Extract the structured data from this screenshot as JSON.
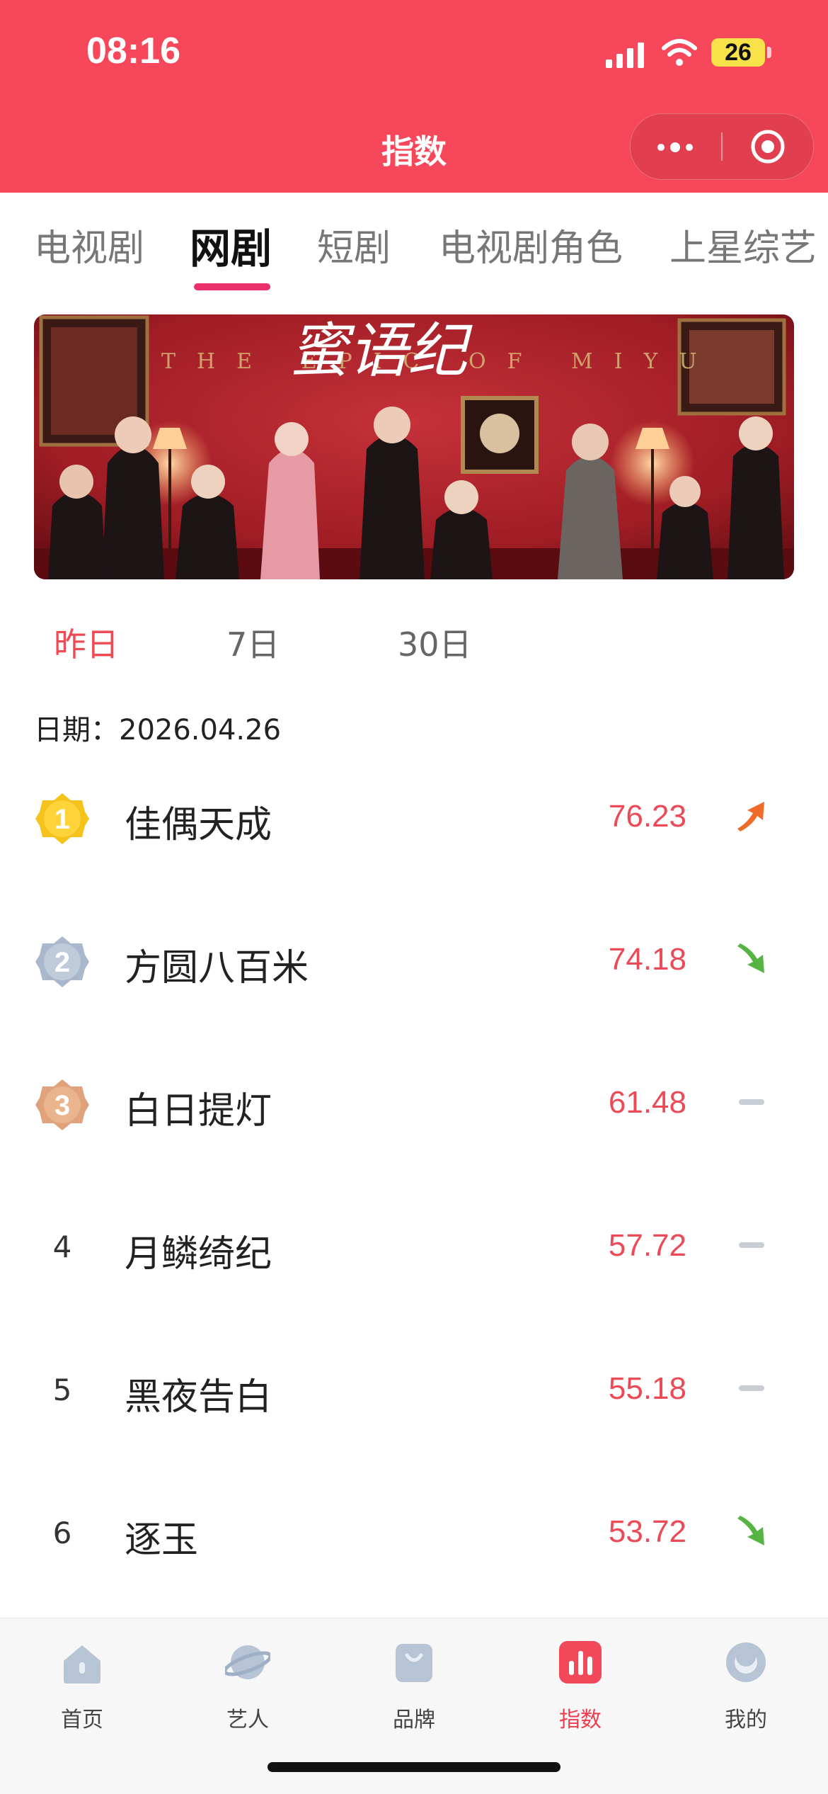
{
  "status_bar": {
    "time": "08:16",
    "battery": "26"
  },
  "header": {
    "title": "指数"
  },
  "tabs": [
    {
      "label": "电视剧",
      "active": false
    },
    {
      "label": "网剧",
      "active": true
    },
    {
      "label": "短剧",
      "active": false
    },
    {
      "label": "电视剧角色",
      "active": false
    },
    {
      "label": "上星综艺",
      "active": false
    }
  ],
  "banner": {
    "title_art": "蜜语纪",
    "subtitle_art": "THE EPIC OF MIYU"
  },
  "periods": [
    {
      "label": "昨日",
      "active": true
    },
    {
      "label": "7日",
      "active": false
    },
    {
      "label": "30日",
      "active": false
    }
  ],
  "date": {
    "label": "日期：",
    "value": "2026.04.26"
  },
  "ranking": [
    {
      "rank": "1",
      "title": "佳偶天成",
      "score": "76.23",
      "trend": "up"
    },
    {
      "rank": "2",
      "title": "方圆八百米",
      "score": "74.18",
      "trend": "down"
    },
    {
      "rank": "3",
      "title": "白日提灯",
      "score": "61.48",
      "trend": "flat"
    },
    {
      "rank": "4",
      "title": "月鳞绮纪",
      "score": "57.72",
      "trend": "flat"
    },
    {
      "rank": "5",
      "title": "黑夜告白",
      "score": "55.18",
      "trend": "flat"
    },
    {
      "rank": "6",
      "title": "逐玉",
      "score": "53.72",
      "trend": "down"
    }
  ],
  "bottom_nav": [
    {
      "label": "首页",
      "icon": "home-icon",
      "active": false
    },
    {
      "label": "艺人",
      "icon": "planet-icon",
      "active": false
    },
    {
      "label": "品牌",
      "icon": "bag-icon",
      "active": false
    },
    {
      "label": "指数",
      "icon": "bar-chart-icon",
      "active": true
    },
    {
      "label": "我的",
      "icon": "profile-icon",
      "active": false
    }
  ],
  "colors": {
    "header": "#f7475a",
    "accent": "#ec4a56",
    "tab_underline": "#ea2f6a",
    "trend_up": "#f06a2a",
    "trend_down": "#55b443",
    "trend_flat": "#c9ced6"
  }
}
